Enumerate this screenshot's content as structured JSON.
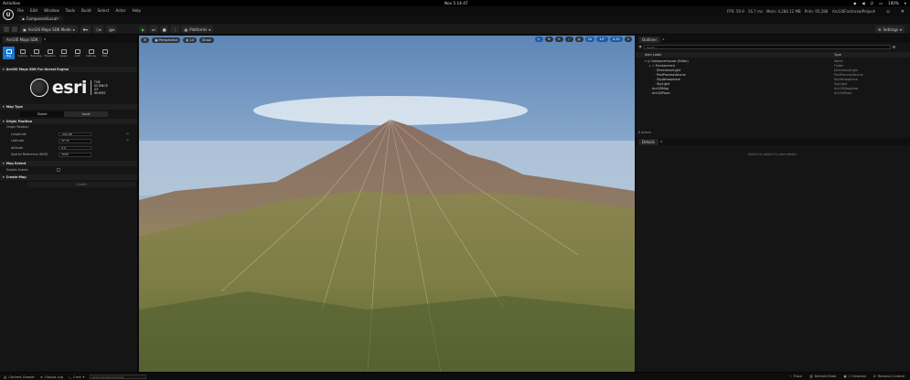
{
  "system_bar": {
    "activities": "Activities",
    "clock": "Nov 5  14:47",
    "battery": "100%"
  },
  "menus": [
    "File",
    "Edit",
    "Window",
    "Tools",
    "Build",
    "Select",
    "Actor",
    "Help"
  ],
  "level_tab": "ComponentLocal•",
  "stats": {
    "fps": "FPS: 59.9",
    "ms": "16.7 ms",
    "mem": "Mem: 4,284.12 MB",
    "prim": "Prim: 95,286"
  },
  "project_name": "ArcGISForUnrealProject",
  "settings_label": "Settings",
  "toolbar": {
    "mode": "ArcGIS Maps SDK Mode",
    "platforms": "Platforms"
  },
  "left_panel": {
    "tab": "ArcGIS Maps SDK",
    "icons": [
      {
        "label": "Map",
        "icon": "map-icon",
        "selected": true
      },
      {
        "label": "Camera",
        "icon": "camera-icon"
      },
      {
        "label": "Basemap",
        "icon": "basemap-icon"
      },
      {
        "label": "Elevation",
        "icon": "elevation-icon"
      },
      {
        "label": "Layers",
        "icon": "layers-icon"
      },
      {
        "label": "Auth",
        "icon": "auth-icon"
      },
      {
        "label": "Settings",
        "icon": "settings-icon"
      },
      {
        "label": "Help",
        "icon": "help-icon"
      }
    ],
    "header": "ArcGIS Maps SDK For Unreal Engine",
    "brand": {
      "wordmark": "esri",
      "tagline": [
        "THE",
        "SCIENCE",
        "OF",
        "WHERE"
      ]
    },
    "map_type": {
      "title": "Map Type",
      "options": [
        "Global",
        "Local"
      ],
      "selected": "Local"
    },
    "origin": {
      "title": "Origin Position",
      "sub": "Origin Position",
      "fields": [
        {
          "label": "Longitude",
          "value": "-122.38"
        },
        {
          "label": "Latitude",
          "value": "37.79"
        },
        {
          "label": "Altitude",
          "value": "0.0"
        },
        {
          "label": "Spatial Reference WKID",
          "value": "4326"
        }
      ]
    },
    "extent": {
      "title": "Map Extent",
      "enable_label": "Enable Extent"
    },
    "create_map": {
      "title": "Create Map",
      "button": "Create"
    }
  },
  "viewport": {
    "buttons": [
      "Perspective",
      "Lit",
      "Show"
    ],
    "right_values": [
      "10",
      "10°",
      "0.25",
      "4"
    ],
    "colors": {
      "sky_top": "#5d86b7",
      "sky_bottom": "#c4d6e6",
      "mountain": "#8a6f63",
      "slope": "#9c935b",
      "foreground": "#7a7a3c"
    }
  },
  "outliner": {
    "tab": "Outliner",
    "search_placeholder": "Search...",
    "columns": {
      "label": "Item Label",
      "type": "Type"
    },
    "rows": [
      {
        "label": "ComponentLocal (Editor)",
        "type": "World",
        "indent": 0
      },
      {
        "label": "Environment",
        "type": "Folder",
        "indent": 1
      },
      {
        "label": "DirectionalLight",
        "type": "DirectionalLight",
        "indent": 2
      },
      {
        "label": "PostProcessVolume",
        "type": "PostProcessVolume",
        "indent": 2
      },
      {
        "label": "SkyAtmosphere",
        "type": "SkyAtmosphere",
        "indent": 2
      },
      {
        "label": "SkyLight",
        "type": "SkyLight",
        "indent": 2
      },
      {
        "label": "ArcGISMap",
        "type": "ArcGISMapActor",
        "indent": 1
      },
      {
        "label": "ArcGISPawn",
        "type": "ArcGISPawn",
        "indent": 1
      }
    ],
    "count": "8 actors"
  },
  "details": {
    "tab": "Details",
    "empty": "Select an object to view details."
  },
  "status": {
    "content_drawer": "Content Drawer",
    "output_log": "Output Log",
    "cmd": "Cmd",
    "console_placeholder": "Enter Console Command",
    "trace": "Trace",
    "derived": "Derived Data",
    "unsaved": "1 Unsaved",
    "revision": "Revision Control"
  }
}
